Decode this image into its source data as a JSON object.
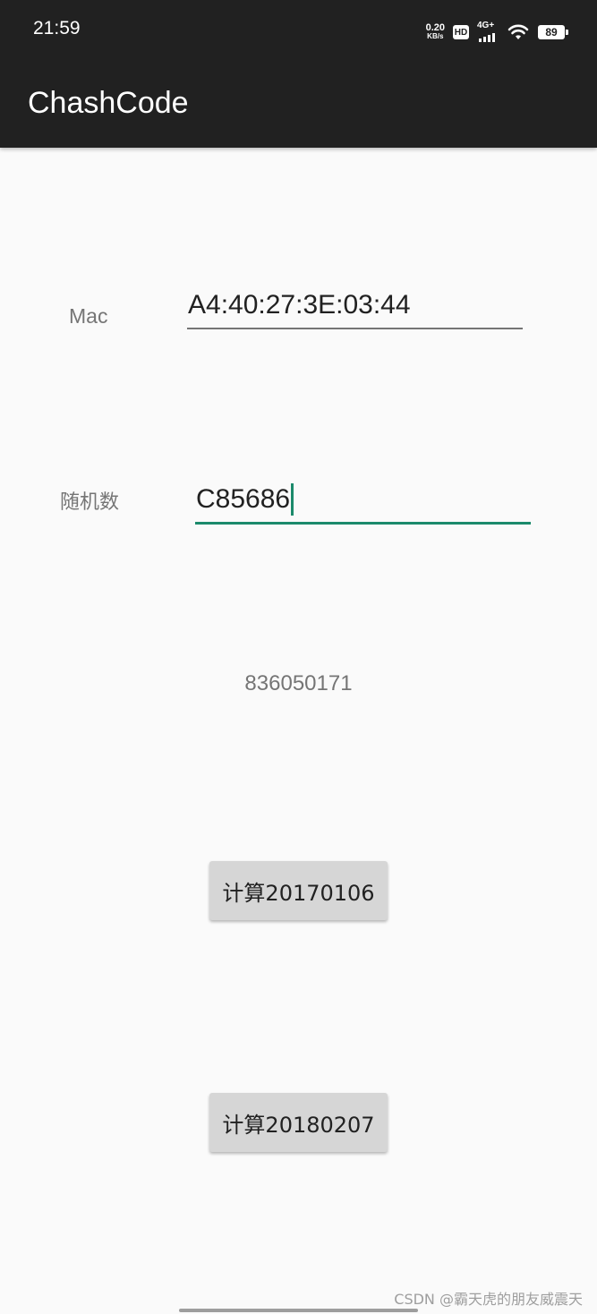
{
  "status_bar": {
    "time": "21:59",
    "net_speed_value": "0.20",
    "net_speed_unit": "KB/s",
    "hd_label": "HD",
    "network_label": "4G+",
    "battery": "89"
  },
  "app_bar": {
    "title": "ChashCode"
  },
  "form": {
    "mac_label": "Mac",
    "mac_value": "A4:40:27:3E:03:44",
    "random_label": "随机数",
    "random_value": "C85686"
  },
  "result": {
    "value": "836050171"
  },
  "buttons": {
    "calc_2017": "计算20170106",
    "calc_2018": "计算20180207"
  },
  "watermark": "CSDN @霸天虎的朋友威震天"
}
